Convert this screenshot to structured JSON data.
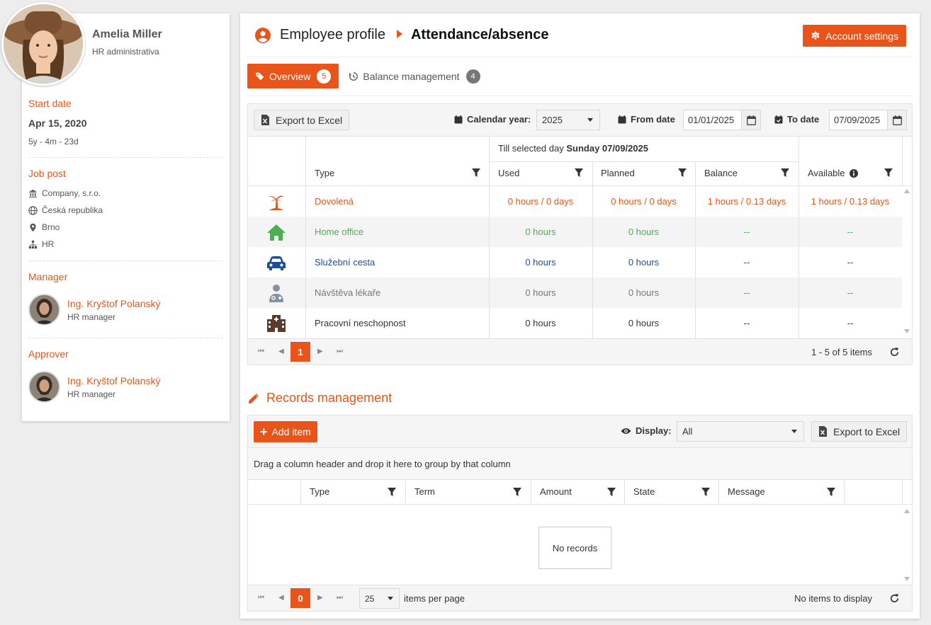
{
  "profile": {
    "name": "Amelia Miller",
    "role": "HR administrativa",
    "start_date_label": "Start date",
    "start_date": "Apr 15, 2020",
    "tenure": "5y - 4m - 23d",
    "job_post_label": "Job post",
    "company": "Company, s.r.o.",
    "country": "Česká republika",
    "city": "Brno",
    "department": "HR",
    "manager_label": "Manager",
    "manager_name": "Ing. Kryštof Polanský",
    "manager_role": "HR manager",
    "approver_label": "Approver",
    "approver_name": "Ing. Kryštof Polanský",
    "approver_role": "HR manager"
  },
  "header": {
    "crumb1": "Employee profile",
    "crumb2": "Attendance/absence",
    "account_settings": "Account settings"
  },
  "tabs": [
    {
      "label": "Overview",
      "count": "5"
    },
    {
      "label": "Balance management",
      "count": "4"
    }
  ],
  "toolbar": {
    "export_label": "Export to Excel",
    "calendar_year_label": "Calendar year:",
    "calendar_year_value": "2025",
    "from_date_label": "From date",
    "from_date_value": "01/01/2025",
    "to_date_label": "To date",
    "to_date_value": "07/09/2025"
  },
  "overview_table": {
    "group_header_prefix": "Till selected day",
    "group_header_date": "Sunday 07/09/2025",
    "columns": {
      "type": "Type",
      "used": "Used",
      "planned": "Planned",
      "balance": "Balance",
      "available": "Available"
    },
    "rows": [
      {
        "icon": "palm-tree-icon",
        "type": "Dovolená",
        "used": "0 hours / 0 days",
        "planned": "0 hours / 0 days",
        "balance": "1 hours / 0.13 days",
        "available": "1 hours / 0.13 days",
        "color": "#e8541a"
      },
      {
        "icon": "home-icon",
        "type": "Home office",
        "used": "0 hours",
        "planned": "0 hours",
        "balance": "--",
        "available": "--",
        "color": "#4caf50"
      },
      {
        "icon": "car-icon",
        "type": "Služební cesta",
        "used": "0 hours",
        "planned": "0 hours",
        "balance": "--",
        "available": "--",
        "color": "#1f4e96"
      },
      {
        "icon": "doctor-icon",
        "type": "Návštěva lékaře",
        "used": "0 hours",
        "planned": "0 hours",
        "balance": "--",
        "available": "--",
        "color": "#777777"
      },
      {
        "icon": "hospital-icon",
        "type": "Pracovní neschopnost",
        "used": "0 hours",
        "planned": "0 hours",
        "balance": "--",
        "available": "--",
        "color": "#5b3a29"
      }
    ],
    "pager": {
      "current": "1",
      "info": "1 - 5 of 5 items"
    }
  },
  "records": {
    "title": "Records management",
    "add_item": "Add item",
    "display_label": "Display:",
    "display_value": "All",
    "export_label": "Export to Excel",
    "group_hint": "Drag a column header and drop it here to group by that column",
    "columns": {
      "type": "Type",
      "term": "Term",
      "amount": "Amount",
      "state": "State",
      "message": "Message"
    },
    "no_records": "No records",
    "pager": {
      "current": "0",
      "per_page": "25",
      "per_page_label": "items per page",
      "info": "No items to display"
    }
  },
  "colors": {
    "accent": "#e8541a",
    "green": "#4caf50",
    "blue": "#1f4e96"
  }
}
